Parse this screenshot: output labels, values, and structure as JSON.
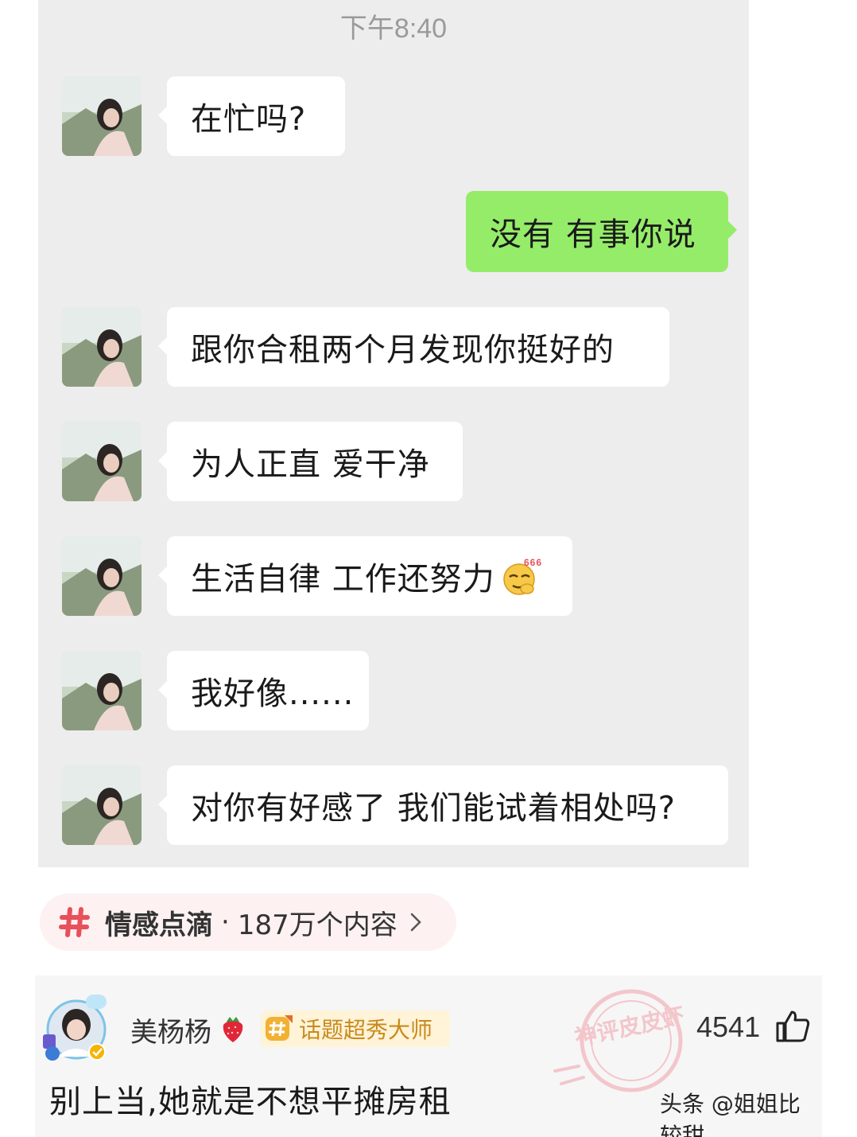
{
  "chat": {
    "timestamp": "下午8:40",
    "messages": [
      {
        "side": "left",
        "text": "在忙吗?"
      },
      {
        "side": "right",
        "text": "没有 有事你说"
      },
      {
        "side": "left",
        "text": "跟你合租两个月发现你挺好的"
      },
      {
        "side": "left",
        "text": "为人正直 爱干净"
      },
      {
        "side": "left",
        "text": "生活自律 工作还努力",
        "emoji": "smug-666-emoji",
        "emoji_text": "666"
      },
      {
        "side": "left",
        "text": "我好像......"
      },
      {
        "side": "left",
        "text": "对你有好感了 我们能试着相处吗?"
      }
    ],
    "colors": {
      "background": "#ededed",
      "left_bubble": "#ffffff",
      "right_bubble": "#95ec69"
    }
  },
  "topic": {
    "icon": "hash-icon",
    "name": "情感点滴",
    "separator": "·",
    "count": "187万个内容",
    "chevron": "chevron-right-icon",
    "accent": "#e8505b"
  },
  "comment": {
    "username": "美杨杨",
    "user_emoji": "strawberry-icon",
    "badge": "话题超秀大师",
    "like_count": "4541",
    "like_icon": "thumbs-up-icon",
    "text": "别上当,她就是不想平摊房租",
    "watermark_stamp": "神评皮皮虾",
    "source_watermark": "头条 @姐姐比较甜"
  }
}
